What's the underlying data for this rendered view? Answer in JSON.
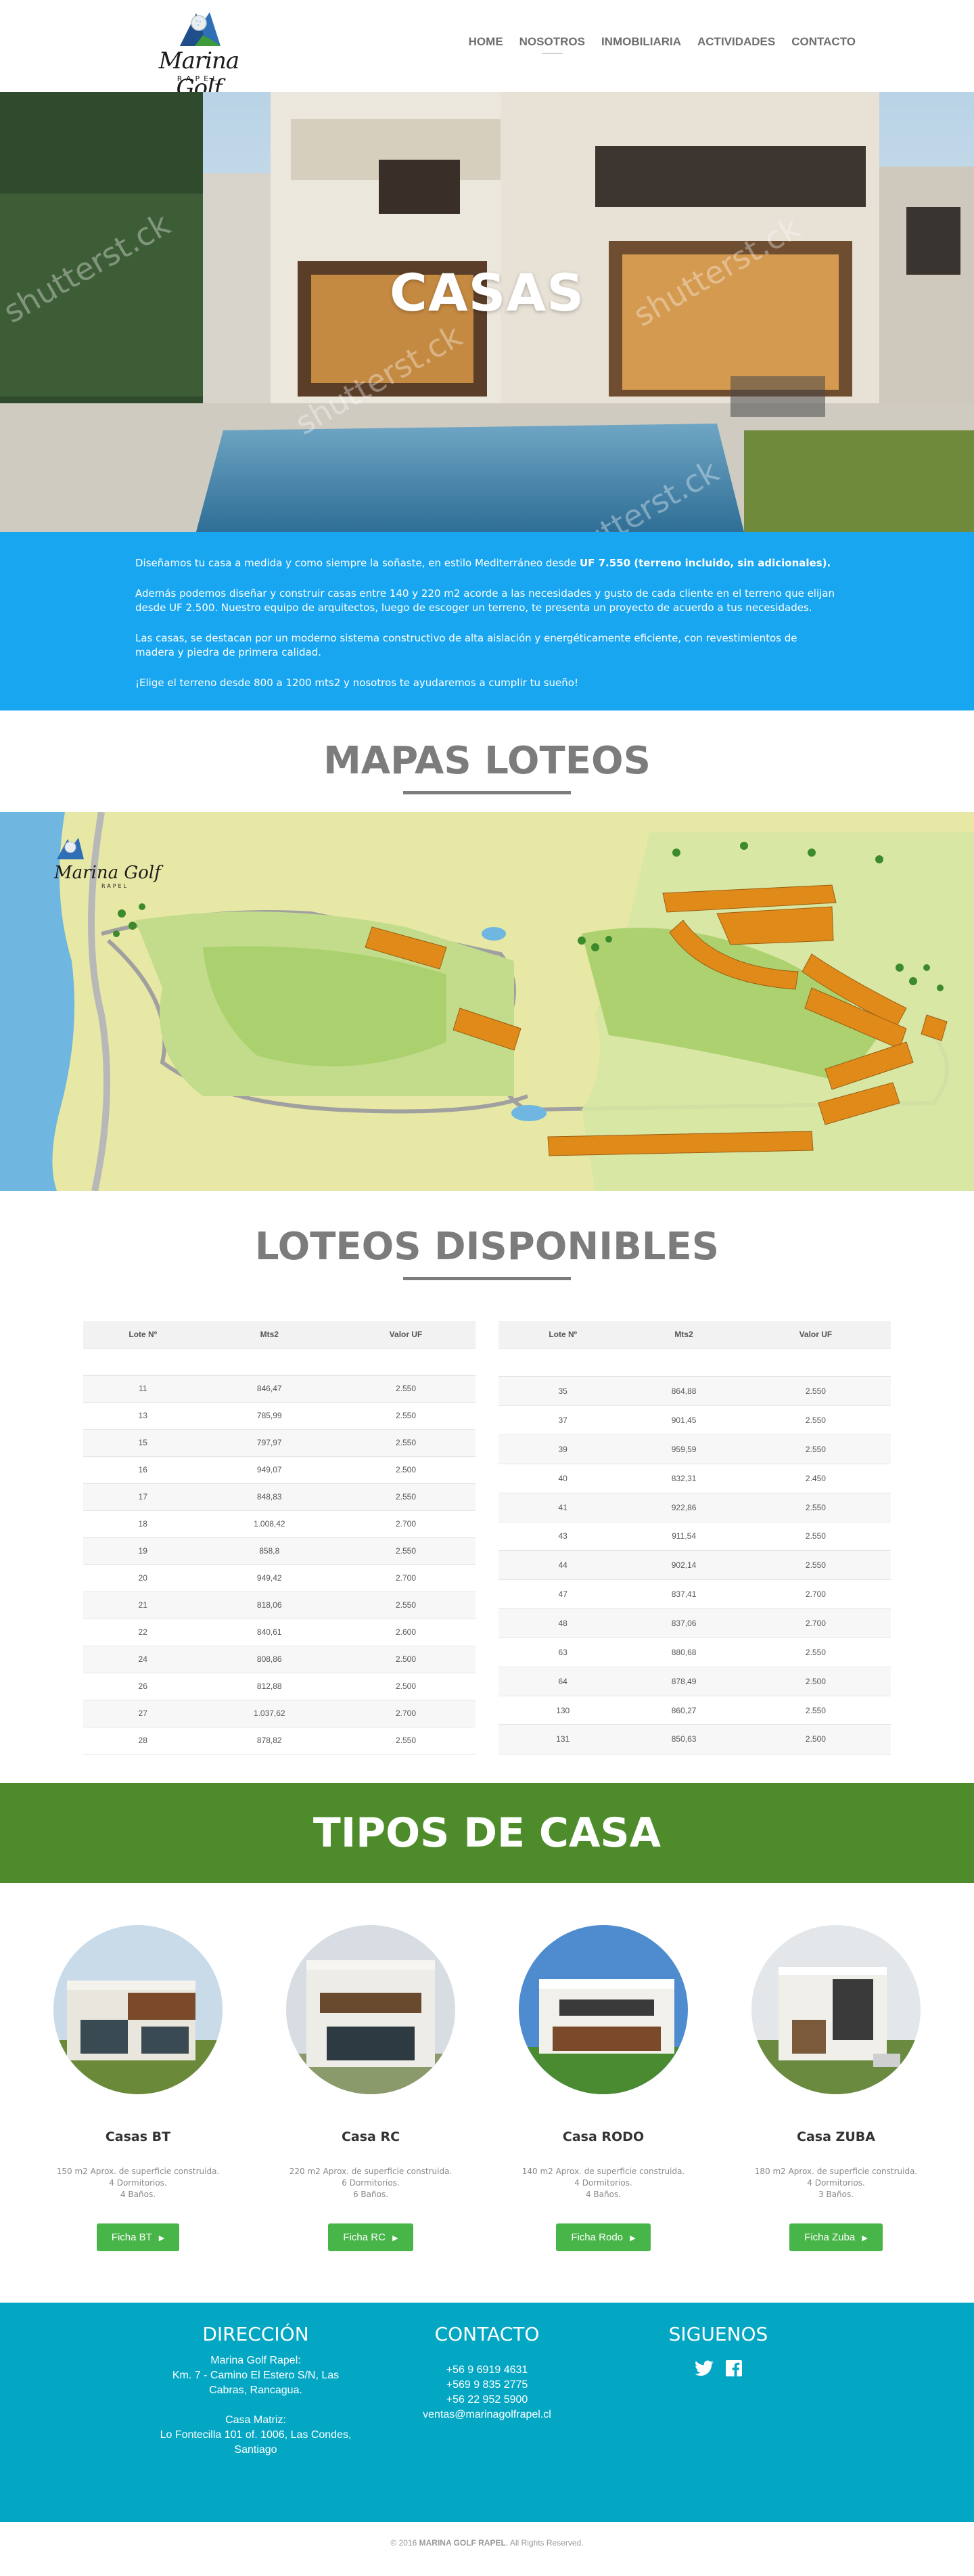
{
  "brand": {
    "name": "Marina Golf",
    "sub": "RAPEL"
  },
  "nav": [
    {
      "label": "HOME"
    },
    {
      "label": "NOSOTROS"
    },
    {
      "label": "INMOBILIARIA"
    },
    {
      "label": "ACTIVIDADES"
    },
    {
      "label": "CONTACTO"
    }
  ],
  "hero": {
    "title": "CASAS",
    "watermark": "shutterst.ck"
  },
  "info": {
    "p1_text": "Diseñamos tu casa a medida y como siempre la soñaste, en estilo Mediterráneo desde ",
    "p1_bold": "UF 7.550 (terreno incluido, sin adicionales).",
    "p2": "Además podemos diseñar y construir casas entre 140 y 220 m2 acorde a las necesidades y gusto de cada cliente en el terreno que elijan desde UF 2.500. Nuestro equipo de arquitectos, luego de escoger un terreno, te presenta un proyecto de acuerdo a tus necesidades.",
    "p3": "Las casas, se destacan por un moderno sistema constructivo de alta aislación y energéticamente eficiente, con revestimientos de madera y piedra de primera calidad.",
    "p4": "¡Elige el terreno desde 800 a 1200 mts2 y nosotros te ayudaremos a cumplir tu sueño!"
  },
  "maps_title": "MAPAS LOTEOS",
  "map": {
    "logo_text": "Marina Golf",
    "logo_sub": "RAPEL"
  },
  "lotes_title": "LOTEOS DISPONIBLES",
  "table_headers": [
    "Lote Nº",
    "Mts2",
    "Valor UF"
  ],
  "table_left": [
    [
      "11",
      "846,47",
      "2.550"
    ],
    [
      "13",
      "785,99",
      "2.550"
    ],
    [
      "15",
      "797,97",
      "2.550"
    ],
    [
      "16",
      "949,07",
      "2.500"
    ],
    [
      "17",
      "848,83",
      "2.550"
    ],
    [
      "18",
      "1.008,42",
      "2.700"
    ],
    [
      "19",
      "858,8",
      "2.550"
    ],
    [
      "20",
      "949,42",
      "2.700"
    ],
    [
      "21",
      "818,06",
      "2.550"
    ],
    [
      "22",
      "840,61",
      "2.600"
    ],
    [
      "24",
      "808,86",
      "2.500"
    ],
    [
      "26",
      "812,88",
      "2.500"
    ],
    [
      "27",
      "1.037,62",
      "2.700"
    ],
    [
      "28",
      "878,82",
      "2.550"
    ]
  ],
  "table_right": [
    [
      "35",
      "864,88",
      "2.550"
    ],
    [
      "37",
      "901,45",
      "2.550"
    ],
    [
      "39",
      "959,59",
      "2.550"
    ],
    [
      "40",
      "832,31",
      "2.450"
    ],
    [
      "41",
      "922,86",
      "2.550"
    ],
    [
      "43",
      "911,54",
      "2.550"
    ],
    [
      "44",
      "902,14",
      "2.550"
    ],
    [
      "47",
      "837,41",
      "2.700"
    ],
    [
      "48",
      "837,06",
      "2.700"
    ],
    [
      "63",
      "880,68",
      "2.550"
    ],
    [
      "64",
      "878,49",
      "2.500"
    ],
    [
      "130",
      "860,27",
      "2.550"
    ],
    [
      "131",
      "850,63",
      "2.500"
    ]
  ],
  "tipos_title": "TIPOS DE CASA",
  "houses": [
    {
      "name": "Casas BT",
      "l1": "150 m2 Aprox. de superficie construida.",
      "l2": "4 Dormitorios.",
      "l3": "4 Baños.",
      "btn": "Ficha BT"
    },
    {
      "name": "Casa RC",
      "l1": "220 m2 Aprox. de superficie construida.",
      "l2": "6 Dormitorios.",
      "l3": "6 Baños.",
      "btn": "Ficha RC"
    },
    {
      "name": "Casa RODO",
      "l1": "140 m2 Aprox. de superficie construida.",
      "l2": "4 Dormitorios.",
      "l3": "4 Baños.",
      "btn": "Ficha Rodo"
    },
    {
      "name": "Casa ZUBA",
      "l1": "180 m2 Aprox. de superficie construida.",
      "l2": "4 Dormitorios.",
      "l3": "3 Baños.",
      "btn": "Ficha Zuba"
    }
  ],
  "footer": {
    "dir_title": "DIRECCIÓN",
    "dir_l1": "Marina Golf Rapel:",
    "dir_l2": "Km. 7 - Camino El Estero S/N, Las Cabras, Rancagua.",
    "dir_l3": "Casa Matriz:",
    "dir_l4": "Lo Fontecilla 101 of. 1006, Las Condes, Santiago",
    "contact_title": "CONTACTO",
    "phone1": "+56 9 6919 4631",
    "phone2": "+569 9 835 2775",
    "phone3": "+56 22 952 5900",
    "email": "ventas@marinagolfrapel.cl",
    "follow_title": "SIGUENOS",
    "copy_pre": "© 2016 ",
    "copy_bold": "MARINA GOLF RAPEL",
    "copy_post": ". All Rights Reserved."
  },
  "colors": {
    "info_blue": "#19a6f0",
    "green_band": "#4e8c2b",
    "button_green": "#48b548",
    "footer_teal": "#03a7c4"
  }
}
